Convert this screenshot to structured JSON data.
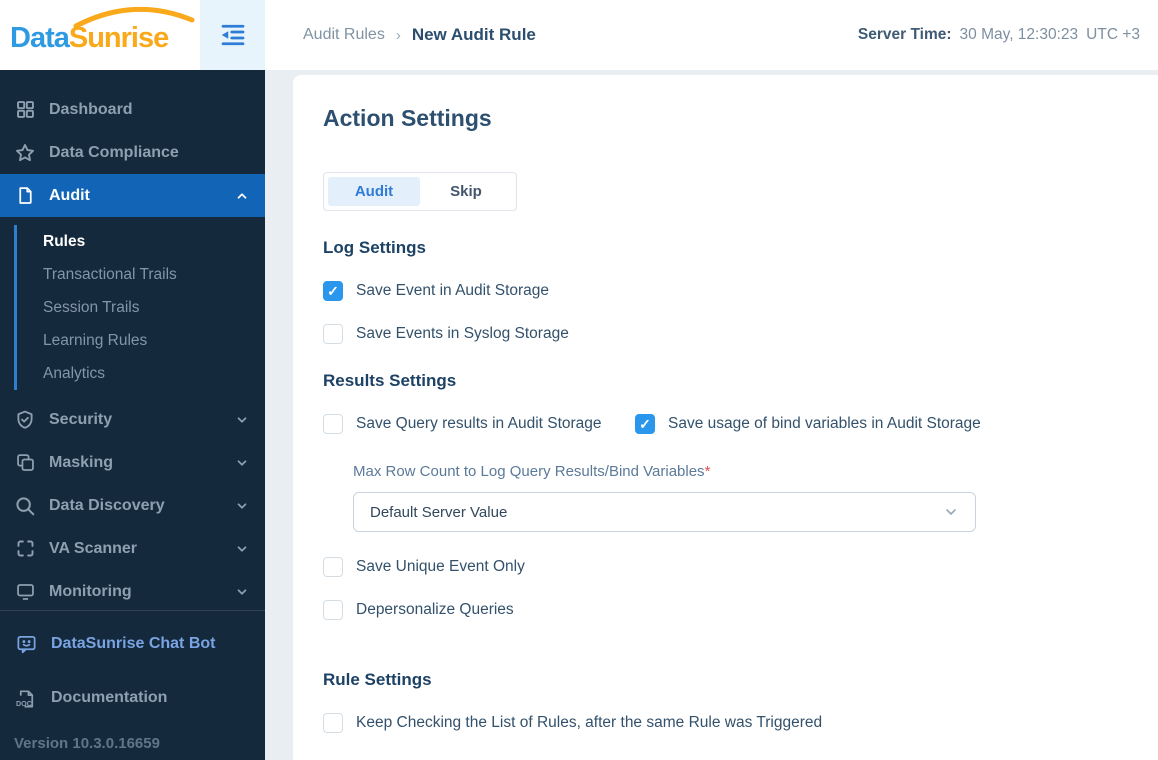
{
  "colors": {
    "sidebar_bg": "#15293c",
    "active_item_bg": "#1164b6",
    "checkbox_checked": "#2b97ec",
    "accent_blue": "#2e7cd6",
    "logo_blue": "#2e9ae2",
    "logo_orange": "#f9a91a"
  },
  "logo": {
    "part1": "Data",
    "part2": "Sunrise"
  },
  "sidebar": {
    "items": [
      {
        "label": "Dashboard",
        "active": false
      },
      {
        "label": "Data Compliance",
        "active": false
      },
      {
        "label": "Audit",
        "active": true,
        "expanded": true
      },
      {
        "label": "Security",
        "active": false
      },
      {
        "label": "Masking",
        "active": false
      },
      {
        "label": "Data Discovery",
        "active": false
      },
      {
        "label": "VA Scanner",
        "active": false
      },
      {
        "label": "Monitoring",
        "active": false
      }
    ],
    "audit_submenu": [
      {
        "label": "Rules",
        "active": true
      },
      {
        "label": "Transactional Trails",
        "active": false
      },
      {
        "label": "Session Trails",
        "active": false
      },
      {
        "label": "Learning Rules",
        "active": false
      },
      {
        "label": "Analytics",
        "active": false
      }
    ],
    "footer": {
      "chat_bot": "DataSunrise Chat Bot",
      "documentation": "Documentation",
      "doc_icon_text": "DOC",
      "version": "Version 10.3.0.16659"
    }
  },
  "header": {
    "breadcrumb_parent": "Audit Rules",
    "breadcrumb_separator": "›",
    "breadcrumb_current": "New Audit Rule",
    "server_time_label": "Server Time:",
    "server_time_value": "30 May, 12:30:23",
    "server_time_zone": "UTC +3"
  },
  "main": {
    "title": "Action Settings",
    "tabs": [
      {
        "label": "Audit",
        "active": true
      },
      {
        "label": "Skip",
        "active": false
      }
    ],
    "log_settings": {
      "title": "Log Settings",
      "checkboxes": [
        {
          "label": "Save Event in Audit Storage",
          "checked": true
        },
        {
          "label": "Save Events in Syslog Storage",
          "checked": false
        }
      ]
    },
    "results_settings": {
      "title": "Results Settings",
      "checkboxes_row": [
        {
          "label": "Save Query results in Audit Storage",
          "checked": false
        },
        {
          "label": "Save usage of bind variables in Audit Storage",
          "checked": true
        }
      ],
      "max_row_label": "Max Row Count to Log Query Results/Bind Variables",
      "required_mark": "*",
      "dropdown_value": "Default Server Value",
      "checkboxes": [
        {
          "label": "Save Unique Event Only",
          "checked": false
        },
        {
          "label": "Depersonalize Queries",
          "checked": false
        }
      ]
    },
    "rule_settings": {
      "title": "Rule Settings",
      "checkboxes": [
        {
          "label": "Keep Checking the List of Rules, after the same Rule was Triggered",
          "checked": false
        }
      ]
    }
  }
}
